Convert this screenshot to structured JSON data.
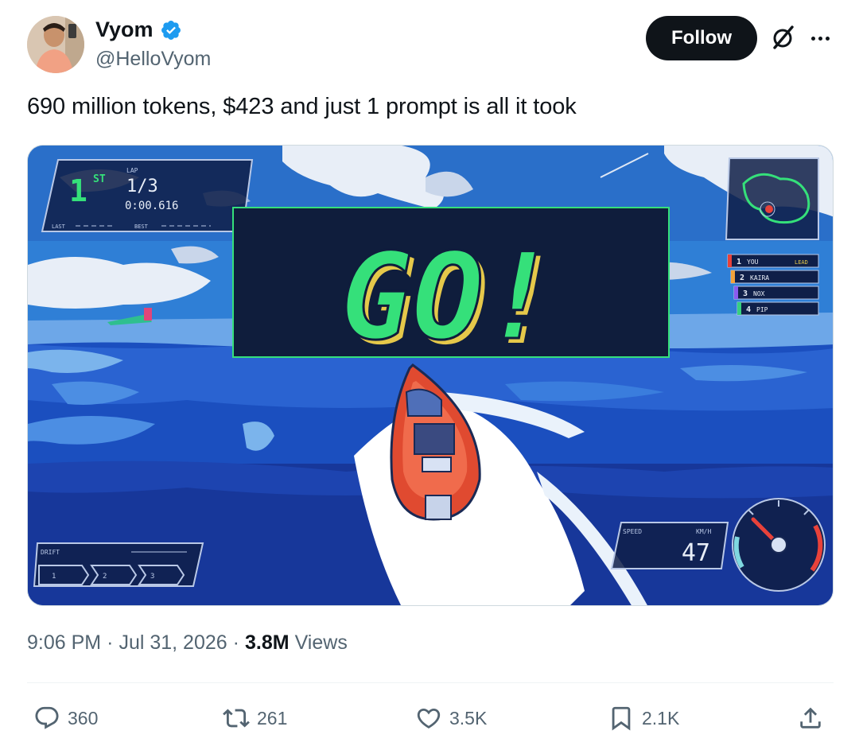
{
  "author": {
    "name": "Vyom",
    "handle": "@HelloVyom",
    "verified_color": "#1d9bf0"
  },
  "follow_label": "Follow",
  "tweet_text": "690 million tokens, $423 and just 1 prompt is all it took",
  "game": {
    "position": "1",
    "position_suffix": "ST",
    "lap_label": "LAP",
    "lap_value": "1/3",
    "lap_time": "0:00.616",
    "last_label": "LAST",
    "best_label": "BEST",
    "go_text": "GO!",
    "leaderboard": [
      {
        "rank": "1",
        "name": "YOU",
        "tag": "LEAD",
        "color": "#e8423a"
      },
      {
        "rank": "2",
        "name": "KAIRA",
        "tag": "",
        "color": "#f2a23a"
      },
      {
        "rank": "3",
        "name": "NOX",
        "tag": "",
        "color": "#8a5cf0"
      },
      {
        "rank": "4",
        "name": "PIP",
        "tag": "",
        "color": "#37d07f"
      }
    ],
    "drift_label": "DRIFT",
    "drift_levels": [
      "1",
      "2",
      "3"
    ],
    "speed_label": "SPEED",
    "speed_unit": "KM/H",
    "speed_value": "47",
    "accent_green": "#35e07a"
  },
  "meta": {
    "time": "9:06 PM",
    "separator": "·",
    "date": "Jul 31, 2026",
    "views_count": "3.8M",
    "views_label": "Views"
  },
  "actions": {
    "replies": "360",
    "reposts": "261",
    "likes": "3.5K",
    "bookmarks": "2.1K"
  },
  "icons": [
    "verified-badge-icon",
    "grok-icon",
    "more-icon",
    "reply-icon",
    "repost-icon",
    "like-icon",
    "bookmark-icon",
    "share-icon"
  ]
}
